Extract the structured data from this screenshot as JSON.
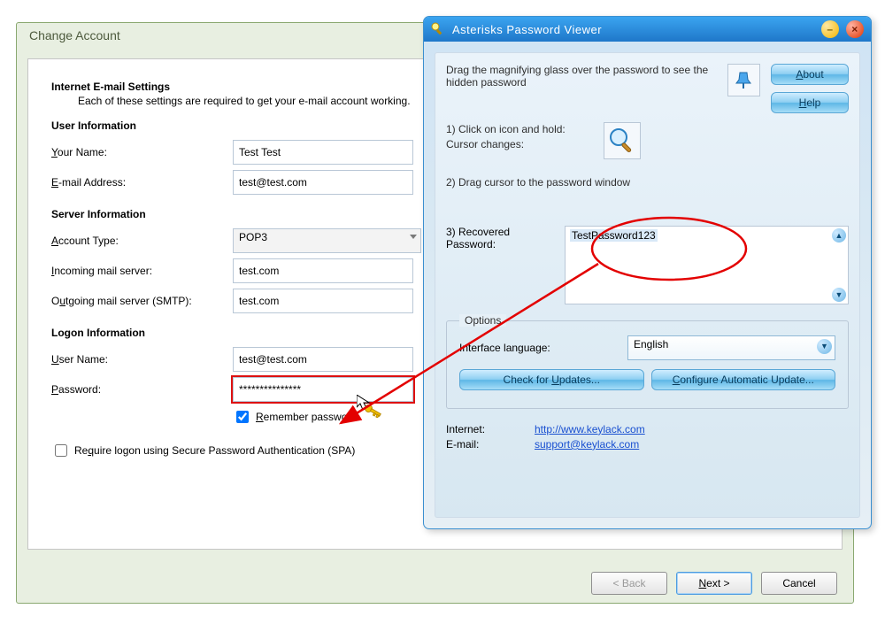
{
  "change_account": {
    "title": "Change Account",
    "header_title": "Internet E-mail Settings",
    "header_desc": "Each of these settings are required to get your e-mail account working.",
    "user_info_head": "User Information",
    "your_name_label": "Your Name:",
    "your_name_value": "Test Test",
    "email_label": "E-mail Address:",
    "email_value": "test@test.com",
    "server_info_head": "Server Information",
    "account_type_label": "Account Type:",
    "account_type_value": "POP3",
    "incoming_label": "Incoming mail server:",
    "incoming_value": "test.com",
    "outgoing_label": "Outgoing mail server (SMTP):",
    "outgoing_value": "test.com",
    "logon_head": "Logon Information",
    "user_name_label": "User Name:",
    "user_name_value": "test@test.com",
    "password_label": "Password:",
    "password_value": "***************",
    "remember_label": "Remember password",
    "remember_checked": true,
    "spa_label": "Require logon using Secure Password Authentication (SPA)",
    "spa_checked": false,
    "back_label": "< Back",
    "next_label": "Next >",
    "cancel_label": "Cancel"
  },
  "viewer": {
    "title": "Asterisks Password Viewer",
    "instructions_top": "Drag the magnifying glass over the password to see the hidden password",
    "about_label": "About",
    "help_label": "Help",
    "step1a": "1) Click on icon and hold:",
    "step1b": "Cursor changes:",
    "step2": "2) Drag cursor to the password window",
    "step3_label": "3) Recovered Password:",
    "recovered_value": "TestPassword123",
    "options_legend": "Options",
    "lang_label": "Interface language:",
    "lang_value": "English",
    "check_updates_label": "Check for Updates...",
    "config_updates_label": "Configure Automatic Update...",
    "internet_label": "Internet:",
    "internet_link": "http://www.keylack.com",
    "email_label": "E-mail:",
    "email_link": "support@keylack.com"
  }
}
